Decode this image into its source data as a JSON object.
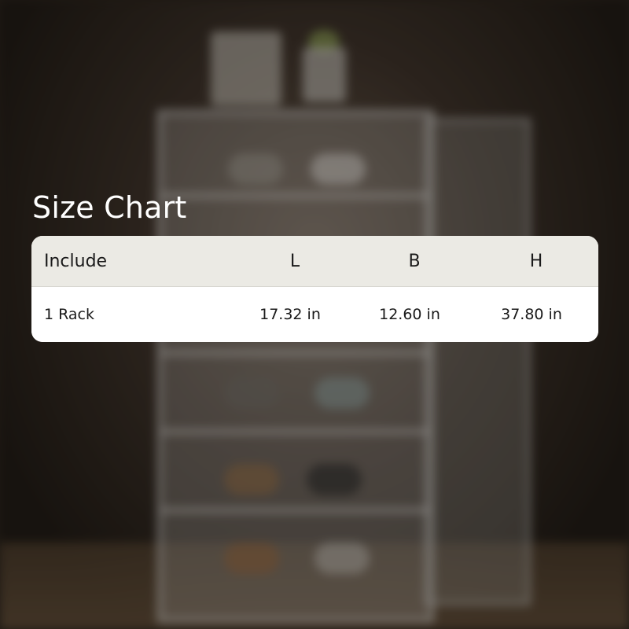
{
  "title": "Size Chart",
  "table": {
    "headers": [
      "Include",
      "L",
      "B",
      "H"
    ],
    "rows": [
      [
        "1 Rack",
        "17.32 in",
        "12.60 in",
        "37.80 in"
      ]
    ]
  },
  "colors": {
    "header_bg": "#ebeae4",
    "row_bg": "#ffffff",
    "title_text": "#ffffff",
    "cell_text": "#1a1a1a"
  }
}
